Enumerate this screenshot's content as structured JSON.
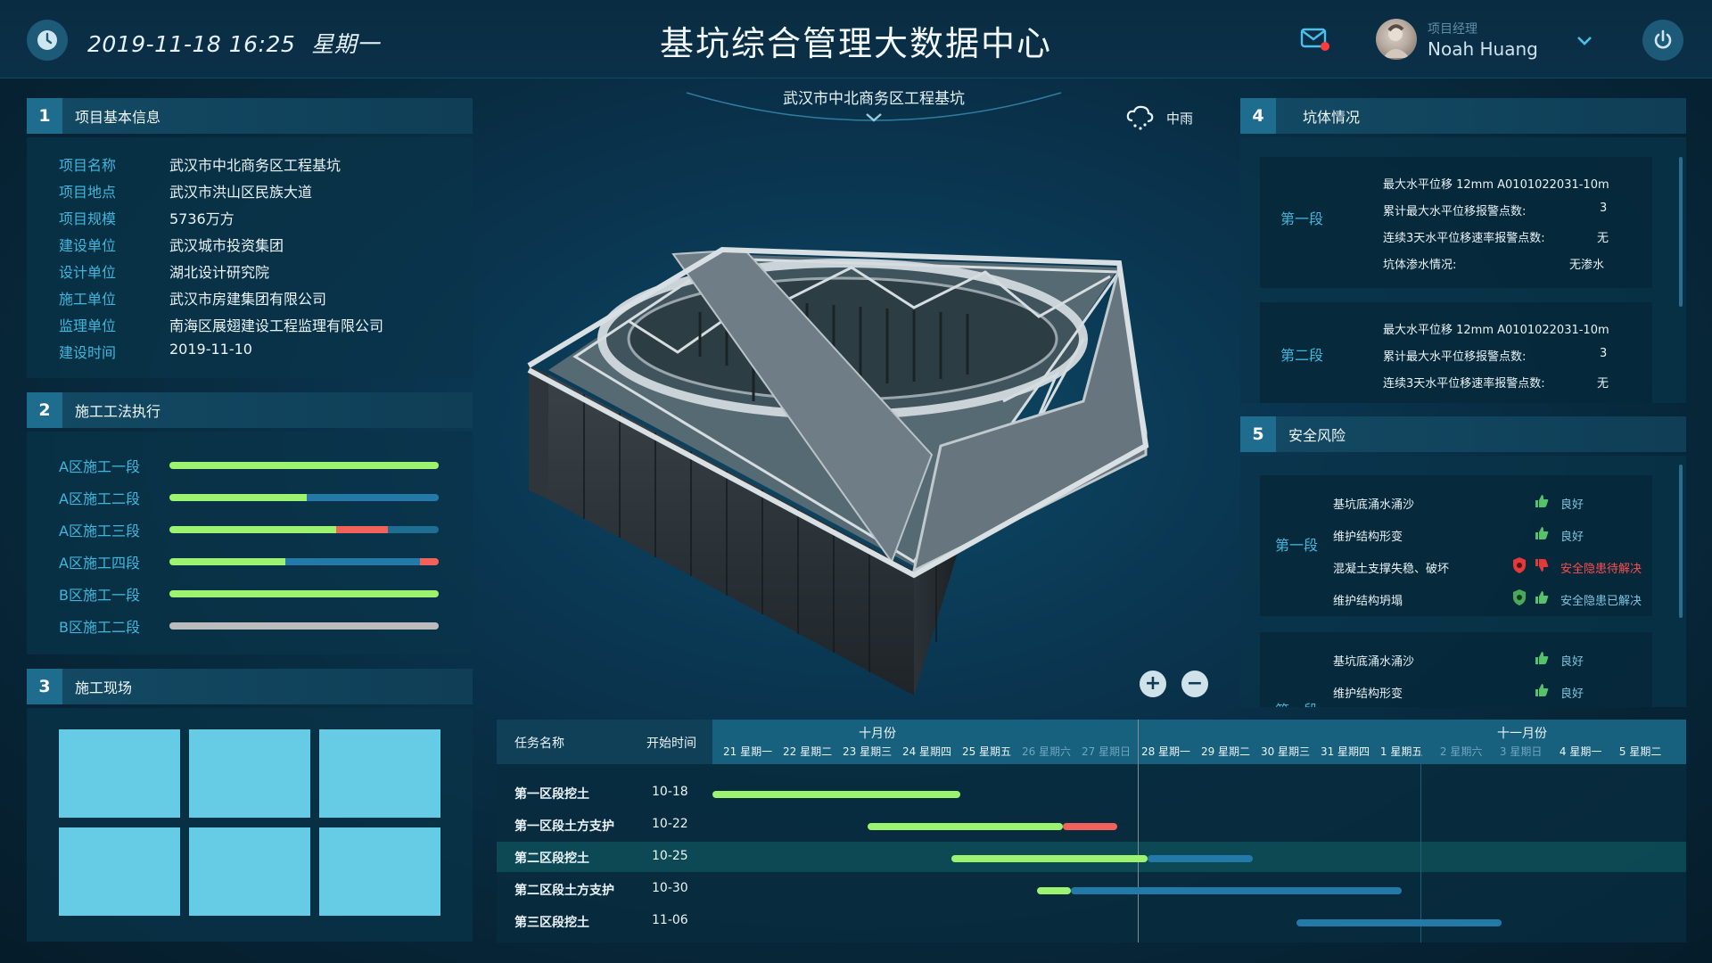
{
  "header": {
    "date": "2019-11-18 16:25",
    "weekday": "星期一",
    "title": "基坑综合管理大数据中心",
    "user_role": "项目经理",
    "user_name": "Noah Huang"
  },
  "colors": {
    "green": "#9bf36f",
    "blue": "#2379a8",
    "red": "#f0625a",
    "gray": "#bcbcbc",
    "accent_text": "#3fb6dc"
  },
  "panel1": {
    "num": "1",
    "title": "项目基本信息",
    "rows": [
      {
        "k": "项目名称",
        "v": "武汉市中北商务区工程基坑"
      },
      {
        "k": "项目地点",
        "v": "武汉市洪山区民族大道"
      },
      {
        "k": "项目规模",
        "v": "5736万方"
      },
      {
        "k": "建设单位",
        "v": "武汉城市投资集团"
      },
      {
        "k": "设计单位",
        "v": "湖北设计研究院"
      },
      {
        "k": "施工单位",
        "v": "武汉市房建集团有限公司"
      },
      {
        "k": "监理单位",
        "v": "南海区展翅建设工程监理有限公司"
      },
      {
        "k": "建设时间",
        "v": "2019-11-10"
      }
    ]
  },
  "panel2": {
    "num": "2",
    "title": "施工工法执行",
    "rows": [
      {
        "label": "A区施工一段",
        "segments": [
          {
            "color": "green",
            "fraction": 1.0
          }
        ]
      },
      {
        "label": "A区施工二段",
        "segments": [
          {
            "color": "green",
            "fraction": 0.51
          },
          {
            "color": "blue",
            "fraction": 0.49
          }
        ]
      },
      {
        "label": "A区施工三段",
        "segments": [
          {
            "color": "green",
            "fraction": 0.62
          },
          {
            "color": "red",
            "fraction": 0.19
          }
        ]
      },
      {
        "label": "A区施工四段",
        "segments": [
          {
            "color": "green",
            "fraction": 0.43
          },
          {
            "color": "blue",
            "fraction": 0.5
          },
          {
            "color": "red",
            "fraction": 0.07
          }
        ]
      },
      {
        "label": "B区施工一段",
        "segments": [
          {
            "color": "green",
            "fraction": 1.0
          }
        ]
      },
      {
        "label": "B区施工二段",
        "segments": [
          {
            "color": "gray",
            "fraction": 1.0
          }
        ]
      }
    ]
  },
  "panel3": {
    "num": "3",
    "title": "施工现场"
  },
  "panel4": {
    "num": "4",
    "title": "坑体情况",
    "sections": [
      {
        "segment": "第一段",
        "lines": [
          {
            "text": "最大水平位移  12mm  A0101022031-10m",
            "value": ""
          },
          {
            "text": "累计最大水平位移报警点数:",
            "value": "3"
          },
          {
            "text": "连续3天水平位移速率报警点数:",
            "value": "无"
          },
          {
            "text": "坑体渗水情况:",
            "value": "无渗水"
          }
        ]
      },
      {
        "segment": "第二段",
        "lines": [
          {
            "text": "最大水平位移  12mm  A0101022031-10m",
            "value": ""
          },
          {
            "text": "累计最大水平位移报警点数:",
            "value": "3"
          },
          {
            "text": "连续3天水平位移速率报警点数:",
            "value": "无"
          }
        ]
      }
    ]
  },
  "panel5": {
    "num": "5",
    "title": "安全风险",
    "sections": [
      {
        "segment": "第一段",
        "items": [
          {
            "name": "基坑底涌水涌沙",
            "status": "良好",
            "level": "good",
            "shield": ""
          },
          {
            "name": "维护结构形变",
            "status": "良好",
            "level": "good",
            "shield": ""
          },
          {
            "name": "混凝土支撑失稳、破坏",
            "status": "安全隐患待解决",
            "level": "bad",
            "shield": "red"
          },
          {
            "name": "维护结构坍塌",
            "status": "安全隐患已解决",
            "level": "good",
            "shield": "green"
          }
        ]
      },
      {
        "segment": "第一段",
        "items": [
          {
            "name": "基坑底涌水涌沙",
            "status": "良好",
            "level": "good",
            "shield": ""
          },
          {
            "name": "维护结构形变",
            "status": "良好",
            "level": "good",
            "shield": ""
          }
        ]
      }
    ]
  },
  "center": {
    "location": "武汉市中北商务区工程基坑",
    "weather": "中雨",
    "weather_icon": "rain-cloud-icon",
    "zoom_in": "+",
    "zoom_out": "−"
  },
  "gantt": {
    "col_task": "任务名称",
    "col_start": "开始时间",
    "months": [
      "十月份",
      "十一月份"
    ],
    "days": [
      {
        "label": "21 星期一",
        "weekend": false
      },
      {
        "label": "22 星期二",
        "weekend": false
      },
      {
        "label": "23 星期三",
        "weekend": false
      },
      {
        "label": "24 星期四",
        "weekend": false
      },
      {
        "label": "25 星期五",
        "weekend": false
      },
      {
        "label": "26 星期六",
        "weekend": true
      },
      {
        "label": "27 星期日",
        "weekend": true
      },
      {
        "label": "28 星期一",
        "weekend": false
      },
      {
        "label": "29 星期二",
        "weekend": false
      },
      {
        "label": "30 星期三",
        "weekend": false
      },
      {
        "label": "31 星期四",
        "weekend": false
      },
      {
        "label": "1 星期五",
        "weekend": false
      },
      {
        "label": "2 星期六",
        "weekend": true
      },
      {
        "label": "3 星期日",
        "weekend": true
      },
      {
        "label": "4 星期一",
        "weekend": false
      },
      {
        "label": "5 星期二",
        "weekend": false
      }
    ],
    "tasks": [
      {
        "name": "第一区段挖土",
        "start": "10-18",
        "bars": [
          {
            "color": "green",
            "from": 0.0,
            "to": 0.255
          }
        ]
      },
      {
        "name": "第一区段土方支护",
        "start": "10-22",
        "bars": [
          {
            "color": "green",
            "from": 0.159,
            "to": 0.36
          },
          {
            "color": "red",
            "from": 0.36,
            "to": 0.416
          }
        ]
      },
      {
        "name": "第二区段挖土",
        "start": "10-25",
        "bars": [
          {
            "color": "green",
            "from": 0.245,
            "to": 0.447
          },
          {
            "color": "blue",
            "from": 0.447,
            "to": 0.555
          }
        ]
      },
      {
        "name": "第二区段土方支护",
        "start": "10-30",
        "bars": [
          {
            "color": "green",
            "from": 0.333,
            "to": 0.368
          },
          {
            "color": "blue",
            "from": 0.368,
            "to": 0.708
          }
        ]
      },
      {
        "name": "第三区段挖土",
        "start": "11-06",
        "bars": [
          {
            "color": "blue",
            "from": 0.6,
            "to": 0.81
          }
        ]
      }
    ]
  }
}
